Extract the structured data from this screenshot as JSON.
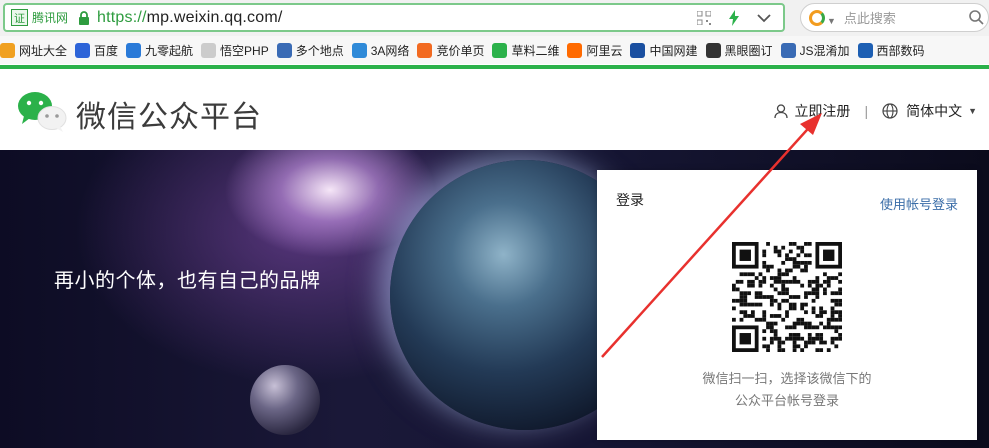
{
  "browser": {
    "cert_label": "证",
    "cert_name": "腾讯网",
    "url_protocol": "https://",
    "url_rest": "mp.weixin.qq.com/",
    "search_placeholder": "点此搜索",
    "bookmarks": [
      {
        "label": "网址大全",
        "icon": "globe-icon",
        "color": "#f0a020"
      },
      {
        "label": "百度",
        "icon": "baidu-paw-icon",
        "color": "#2d64d8"
      },
      {
        "label": "九零起航",
        "icon": "jiuling-icon",
        "color": "#2a7ad8"
      },
      {
        "label": "悟空PHP",
        "icon": "page-icon",
        "color": "#cccccc"
      },
      {
        "label": "多个地点",
        "icon": "bookmark-blue-icon",
        "color": "#3a6bb5"
      },
      {
        "label": "3A网络",
        "icon": "3a-logo-icon",
        "color": "#2f8ad8"
      },
      {
        "label": "竞价单页",
        "icon": "taobao-icon",
        "color": "#f26a21"
      },
      {
        "label": "草料二维",
        "icon": "qr-green-icon",
        "color": "#2bb14a"
      },
      {
        "label": "阿里云",
        "icon": "aliyun-icon",
        "color": "#ff6a00"
      },
      {
        "label": "中国网建",
        "icon": "web-icon",
        "color": "#1a4fa0"
      },
      {
        "label": "黑眼圈订",
        "icon": "eye-icon",
        "color": "#333333"
      },
      {
        "label": "JS混淆加",
        "icon": "bookmark-blue-icon",
        "color": "#3a6bb5"
      },
      {
        "label": "西部数码",
        "icon": "west-icon",
        "color": "#1d5fb3"
      }
    ]
  },
  "header": {
    "brand_title": "微信公众平台",
    "register_label": "立即注册",
    "separator": "|",
    "language_label": "简体中文"
  },
  "hero": {
    "slogan": "再小的个体，也有自己的品牌"
  },
  "login": {
    "title": "登录",
    "switch_label": "使用帐号登录",
    "tip_line1": "微信扫一扫，选择该微信下的",
    "tip_line2": "公众平台帐号登录"
  },
  "colors": {
    "wechat_green": "#2bb14a",
    "link_blue": "#3b6ea8",
    "annotation_red": "#e8312e"
  }
}
